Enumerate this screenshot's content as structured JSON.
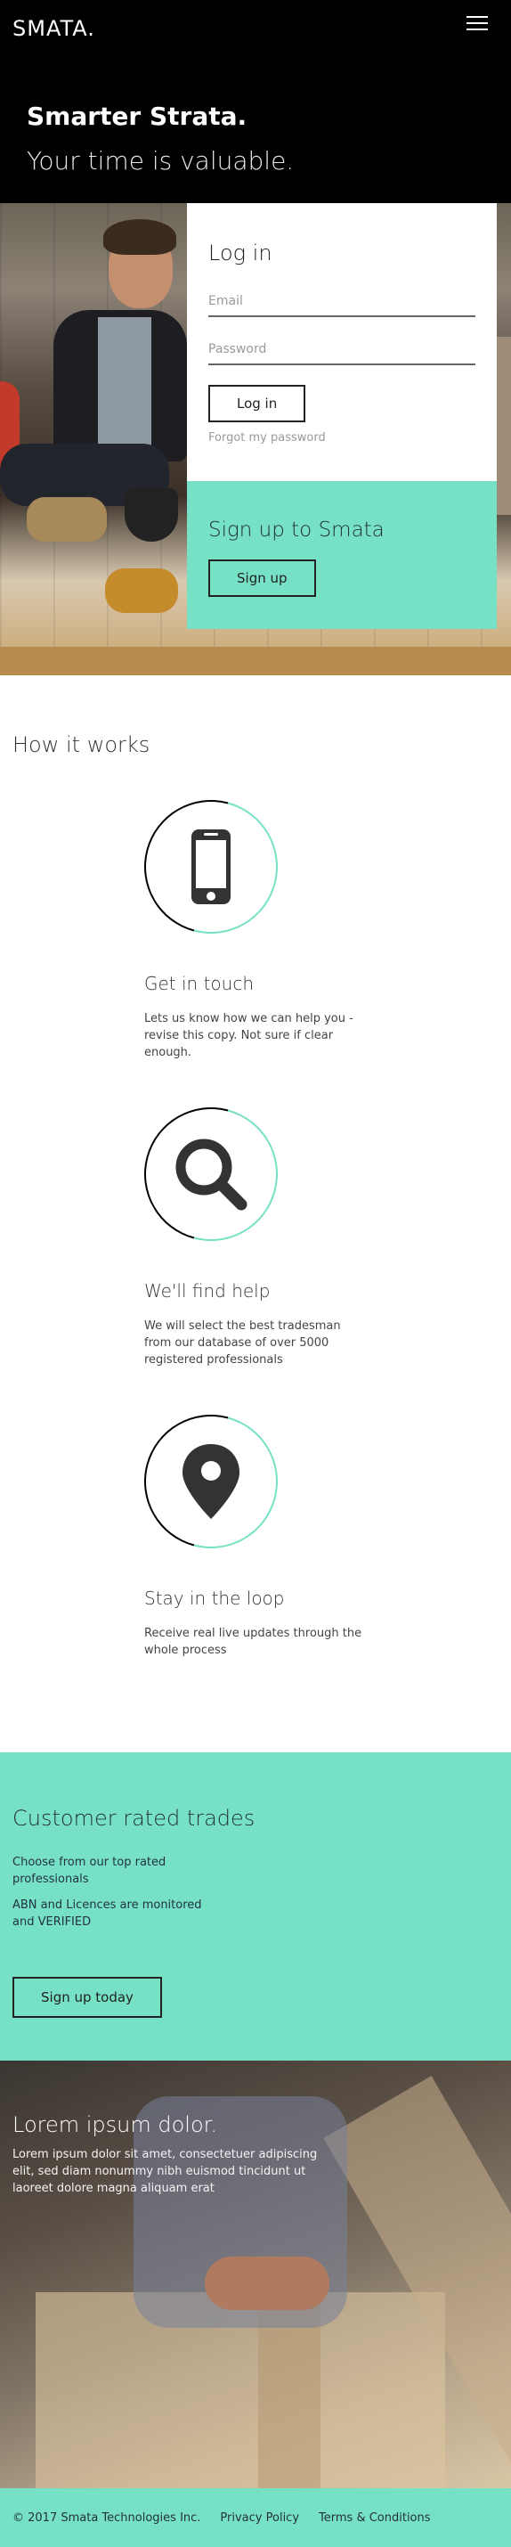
{
  "header": {
    "logo": "SMATA.",
    "hero_title": "Smarter Strata.",
    "hero_subtitle": "Your time is valuable."
  },
  "login": {
    "title": "Log in",
    "email_placeholder": "Email",
    "password_placeholder": "Password",
    "login_button": "Log in",
    "forgot_link": "Forgot my password"
  },
  "signup": {
    "title": "Sign up to Smata",
    "button": "Sign up"
  },
  "how_it_works": {
    "title": "How it works",
    "steps": [
      {
        "icon": "phone-icon",
        "title": "Get in touch",
        "text": "Lets us know how we can help you - revise this copy. Not sure if clear enough."
      },
      {
        "icon": "search-icon",
        "title": "We'll find help",
        "text": "We will select the best tradesman from our database of over 5000 registered professionals"
      },
      {
        "icon": "map-pin-icon",
        "title": "Stay in the loop",
        "text": "Receive real live updates through the whole process"
      }
    ]
  },
  "trades": {
    "title": "Customer rated trades",
    "line1": "Choose from our top rated professionals",
    "line2": "ABN and Licences are monitored and VERIFIED",
    "button": "Sign up today"
  },
  "promo": {
    "title": "Lorem ipsum dolor.",
    "text": "Lorem ipsum dolor sit amet, consectetuer adipiscing elit, sed diam nonummy nibh euismod tincidunt ut laoreet dolore magna aliquam erat"
  },
  "footer": {
    "copyright": "© 2017 Smata Technologies Inc.",
    "privacy": "Privacy Policy",
    "terms": "Terms & Conditions"
  },
  "colors": {
    "accent": "#77e1c6",
    "header_bg": "#000000"
  }
}
